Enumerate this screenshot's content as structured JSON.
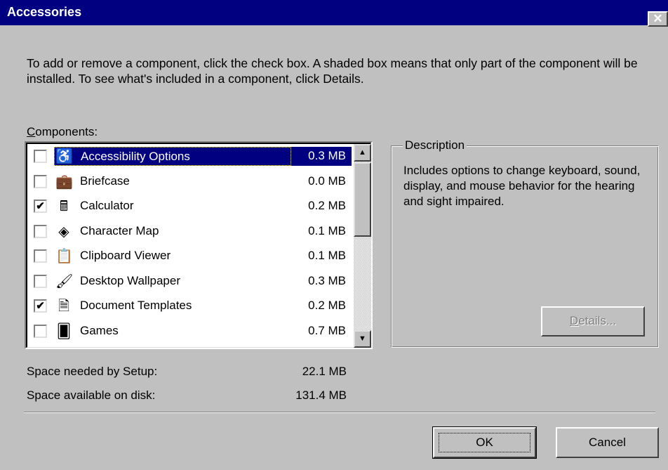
{
  "window": {
    "title": "Accessories",
    "close_label": "✕"
  },
  "intro_text": "To add or remove a component, click the check box. A shaded box means that only part of the component will be installed. To see what's included in a component, click Details.",
  "components_label": {
    "first": "C",
    "rest": "omponents:"
  },
  "components": [
    {
      "name": "Accessibility Options",
      "size": "0.3 MB",
      "checked": false,
      "selected": true,
      "icon": "accessibility-icon",
      "glyph": "♿"
    },
    {
      "name": "Briefcase",
      "size": "0.0 MB",
      "checked": false,
      "selected": false,
      "icon": "briefcase-icon",
      "glyph": "💼"
    },
    {
      "name": "Calculator",
      "size": "0.2 MB",
      "checked": true,
      "selected": false,
      "icon": "calculator-icon",
      "glyph": "🖩"
    },
    {
      "name": "Character Map",
      "size": "0.1 MB",
      "checked": false,
      "selected": false,
      "icon": "character-map-icon",
      "glyph": "◈"
    },
    {
      "name": "Clipboard Viewer",
      "size": "0.1 MB",
      "checked": false,
      "selected": false,
      "icon": "clipboard-icon",
      "glyph": "📋"
    },
    {
      "name": "Desktop Wallpaper",
      "size": "0.3 MB",
      "checked": false,
      "selected": false,
      "icon": "wallpaper-icon",
      "glyph": "🖌"
    },
    {
      "name": "Document Templates",
      "size": "0.2 MB",
      "checked": true,
      "selected": false,
      "icon": "document-template-icon",
      "glyph": "🗎"
    },
    {
      "name": "Games",
      "size": "0.7 MB",
      "checked": false,
      "selected": false,
      "icon": "games-icon",
      "glyph": "🂠"
    }
  ],
  "checkmark": "✔",
  "scroll": {
    "up": "▲",
    "down": "▼"
  },
  "description": {
    "legend": "Description",
    "text": "Includes options to change keyboard, sound, display, and mouse behavior for the hearing and sight impaired."
  },
  "details_button": {
    "first": "D",
    "rest": "etails..."
  },
  "space": {
    "needed_label": "Space needed by Setup:",
    "needed_value": "22.1 MB",
    "available_label": "Space available on disk:",
    "available_value": "131.4 MB"
  },
  "buttons": {
    "ok": "OK",
    "cancel": "Cancel"
  },
  "colors": {
    "title_bar": "#000080",
    "selection": "#000080",
    "face": "#c0c0c0"
  }
}
